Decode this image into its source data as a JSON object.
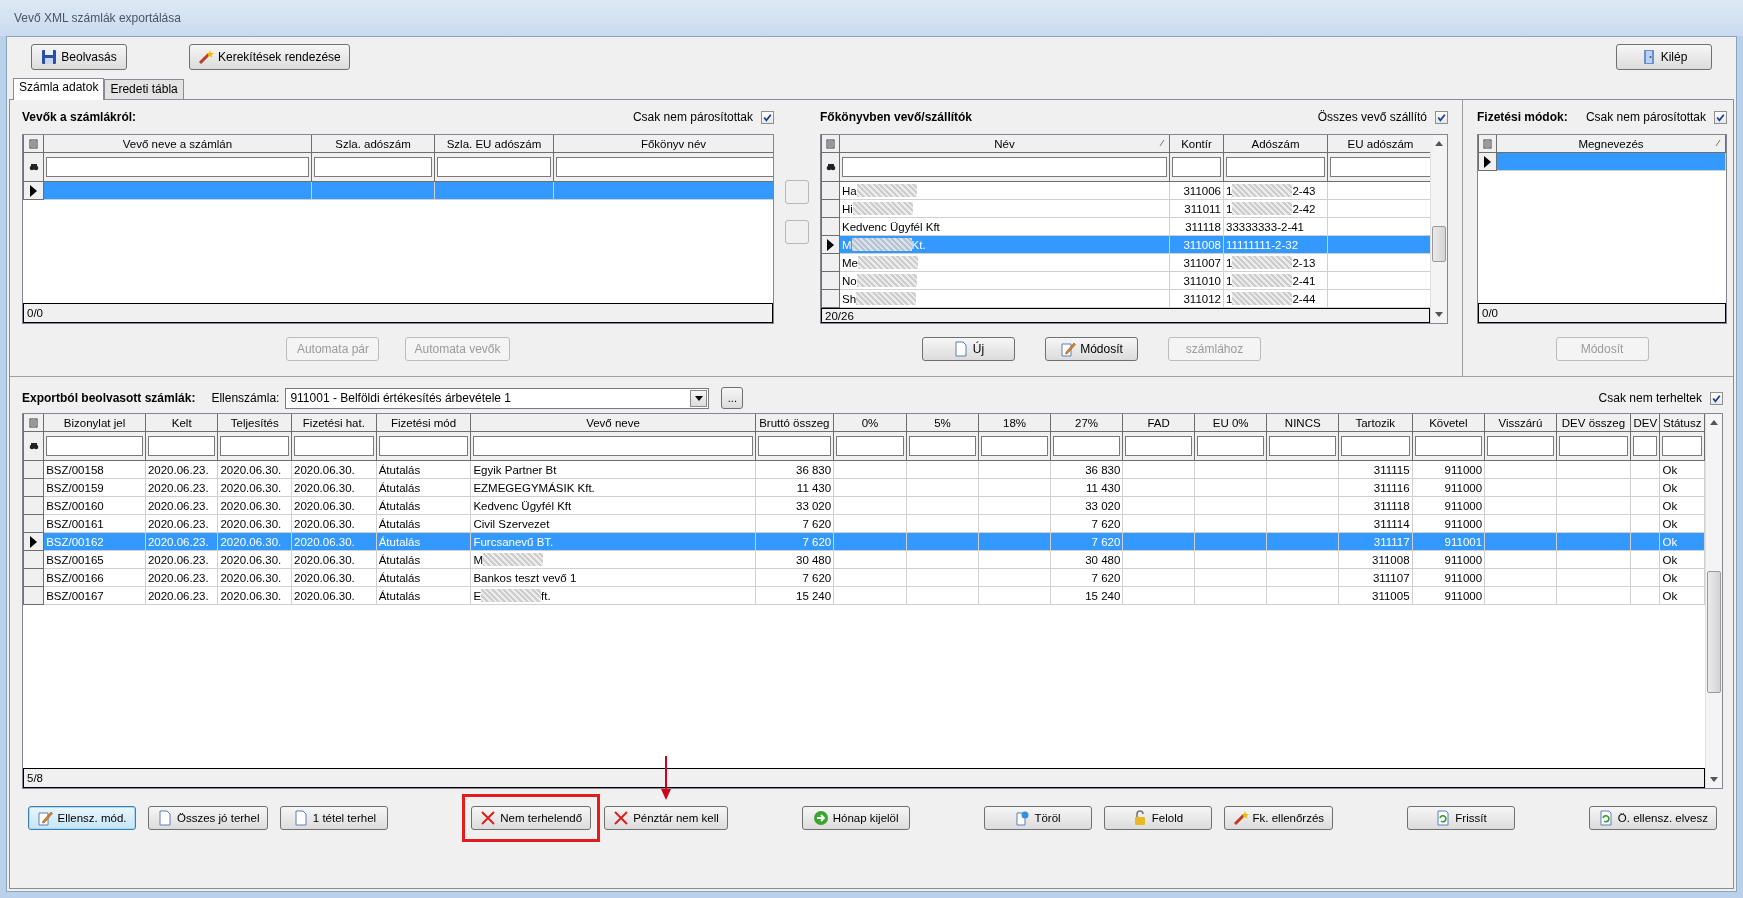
{
  "window": {
    "title": "Vevő XML számlák exportálása"
  },
  "toolbar": {
    "buttons": [
      {
        "label": "Beolvasás"
      },
      {
        "label": "Kerekítések rendezése"
      }
    ],
    "exit": {
      "label": "Kilép"
    }
  },
  "tabs": [
    {
      "label": "Számla adatok",
      "selected": true
    },
    {
      "label": "Eredeti tábla",
      "selected": false
    }
  ],
  "customers_panel": {
    "title": "Vevők a számlákról:",
    "filter": {
      "label": "Csak nem párosítottak",
      "checked": true
    },
    "columns": [
      {
        "label": "Vevő neve a számlán"
      },
      {
        "label": "Szla. adószám"
      },
      {
        "label": "Szla. EU adószám"
      },
      {
        "label": "Főkönyv név"
      }
    ],
    "rows": [
      {
        "selected": true,
        "cells": [
          null,
          null,
          null,
          null
        ]
      }
    ],
    "footer": "0/0",
    "buttons": [
      {
        "label": "Automata pár",
        "disabled": true
      },
      {
        "label": "Automata vevők",
        "disabled": true
      }
    ]
  },
  "ledger_panel": {
    "title": "Főkönyvben vevő/szállítók",
    "filter": {
      "label": "Összes vevő szállító",
      "checked": true
    },
    "columns": [
      {
        "label": "Név",
        "sorted": true
      },
      {
        "label": "Kontír"
      },
      {
        "label": "Adószám"
      },
      {
        "label": "EU adószám"
      }
    ],
    "rows": [
      {
        "selected": false,
        "cells": [
          {
            "text": "Ha",
            "redacted": true
          },
          "311006",
          {
            "text": "1",
            "redacted": true,
            "tail": "2-43"
          },
          null
        ]
      },
      {
        "selected": false,
        "cells": [
          {
            "text": "Hi",
            "redacted": true
          },
          "311011",
          {
            "text": "1",
            "redacted": true,
            "tail": "2-42"
          },
          null
        ]
      },
      {
        "selected": false,
        "cells": [
          "Kedvenc Ügyfél Kft",
          "311118",
          "33333333-2-41",
          null
        ]
      },
      {
        "selected": true,
        "cells": [
          {
            "text": "M",
            "redacted": true,
            "tail": "Kt."
          },
          "311008",
          "11111111-2-32",
          null
        ]
      },
      {
        "selected": false,
        "cells": [
          {
            "text": "Me",
            "redacted": true
          },
          "311007",
          {
            "text": "1",
            "redacted": true,
            "tail": "2-13"
          },
          null
        ]
      },
      {
        "selected": false,
        "cells": [
          {
            "text": "No",
            "redacted": true
          },
          "311010",
          {
            "text": "1",
            "redacted": true,
            "tail": "2-41"
          },
          null
        ]
      },
      {
        "selected": false,
        "cells": [
          {
            "text": "Sh",
            "redacted": true
          },
          "311012",
          {
            "text": "1",
            "redacted": true,
            "tail": "2-44"
          },
          null
        ]
      }
    ],
    "footer": "20/26",
    "buttons": [
      {
        "label": "Új",
        "disabled": false
      },
      {
        "label": "Módosít",
        "disabled": false
      },
      {
        "label": "számlához",
        "disabled": true
      }
    ]
  },
  "payment_panel": {
    "title": "Fizetési módok:",
    "filter": {
      "label": "Csak nem párosítottak",
      "checked": true
    },
    "columns": [
      {
        "label": "Megnevezés",
        "sorted": true
      }
    ],
    "rows": [
      {
        "selected": true,
        "cells": [
          null
        ]
      }
    ],
    "footer": "0/0",
    "buttons": [
      {
        "label": "Módosít",
        "disabled": true
      }
    ]
  },
  "invoices": {
    "title": "Exportból beolvasott számlák:",
    "counter_account": {
      "label": "Ellenszámla:",
      "value": "911001 - Belföldi értékesítés árbevétele 1"
    },
    "browse": "...",
    "filter": {
      "label": "Csak nem terheltek",
      "checked": true
    },
    "columns": [
      {
        "label": "Bizonylat jel"
      },
      {
        "label": "Kelt"
      },
      {
        "label": "Teljesítés"
      },
      {
        "label": "Fizetési hat."
      },
      {
        "label": "Fizetési mód"
      },
      {
        "label": "Vevő neve"
      },
      {
        "label": "Bruttó összeg"
      },
      {
        "label": "0%"
      },
      {
        "label": "5%"
      },
      {
        "label": "18%"
      },
      {
        "label": "27%"
      },
      {
        "label": "FAD"
      },
      {
        "label": "EU 0%"
      },
      {
        "label": "NINCS"
      },
      {
        "label": "Tartozik"
      },
      {
        "label": "Követel"
      },
      {
        "label": "Visszárú"
      },
      {
        "label": "DEV összeg"
      },
      {
        "label": "DEV"
      },
      {
        "label": "Státusz"
      }
    ],
    "rows": [
      {
        "selected": false,
        "cells": [
          "BSZ/00158",
          "2020.06.23.",
          "2020.06.30.",
          "2020.06.30.",
          "Átutalás",
          "Egyik Partner Bt",
          "36 830",
          null,
          null,
          null,
          "36 830",
          null,
          null,
          null,
          "311115",
          "911000",
          null,
          null,
          null,
          "Ok"
        ]
      },
      {
        "selected": false,
        "cells": [
          "BSZ/00159",
          "2020.06.23.",
          "2020.06.30.",
          "2020.06.30.",
          "Átutalás",
          "EZMEGEGYMÁSIK Kft.",
          "11 430",
          null,
          null,
          null,
          "11 430",
          null,
          null,
          null,
          "311116",
          "911000",
          null,
          null,
          null,
          "Ok"
        ]
      },
      {
        "selected": false,
        "cells": [
          "BSZ/00160",
          "2020.06.23.",
          "2020.06.30.",
          "2020.06.30.",
          "Átutalás",
          "Kedvenc Ügyfél Kft",
          "33 020",
          null,
          null,
          null,
          "33 020",
          null,
          null,
          null,
          "311118",
          "911000",
          null,
          null,
          null,
          "Ok"
        ]
      },
      {
        "selected": false,
        "cells": [
          "BSZ/00161",
          "2020.06.23.",
          "2020.06.30.",
          "2020.06.30.",
          "Átutalás",
          "Civil Szervezet",
          "7 620",
          null,
          null,
          null,
          "7 620",
          null,
          null,
          null,
          "311114",
          "911000",
          null,
          null,
          null,
          "Ok"
        ]
      },
      {
        "selected": true,
        "cells": [
          "BSZ/00162",
          "2020.06.23.",
          "2020.06.30.",
          "2020.06.30.",
          "Átutalás",
          "Furcsanevű BT.",
          "7 620",
          null,
          null,
          null,
          "7 620",
          null,
          null,
          null,
          "311117",
          "911001",
          null,
          null,
          null,
          "Ok"
        ]
      },
      {
        "selected": false,
        "cells": [
          "BSZ/00165",
          "2020.06.23.",
          "2020.06.30.",
          "2020.06.30.",
          "Átutalás",
          {
            "text": "M",
            "redacted": true
          },
          "30 480",
          null,
          null,
          null,
          "30 480",
          null,
          null,
          null,
          "311008",
          "911000",
          null,
          null,
          null,
          "Ok"
        ]
      },
      {
        "selected": false,
        "cells": [
          "BSZ/00166",
          "2020.06.23.",
          "2020.06.30.",
          "2020.06.30.",
          "Átutalás",
          "Bankos teszt vevő 1",
          "7 620",
          null,
          null,
          null,
          "7 620",
          null,
          null,
          null,
          "311107",
          "911000",
          null,
          null,
          null,
          "Ok"
        ]
      },
      {
        "selected": false,
        "cells": [
          "BSZ/00167",
          "2020.06.23.",
          "2020.06.30.",
          "2020.06.30.",
          "Átutalás",
          {
            "text": "E",
            "redacted": true,
            "tail": "ft."
          },
          "15 240",
          null,
          null,
          null,
          "15 240",
          null,
          null,
          null,
          "311005",
          "911000",
          null,
          null,
          null,
          "Ok"
        ]
      }
    ],
    "footer": "5/8"
  },
  "bottom_buttons": [
    {
      "label": "Ellensz. mód.",
      "focused": true,
      "highlighted": false,
      "arrow": false
    },
    {
      "label": "Összes jó terhel",
      "focused": false,
      "highlighted": false,
      "arrow": false
    },
    {
      "label": "1 tétel terhel",
      "focused": false,
      "highlighted": false,
      "arrow": false
    },
    {
      "label": "Nem terhelendő",
      "focused": false,
      "highlighted": true,
      "arrow": false
    },
    {
      "label": "Pénztár nem kell",
      "focused": false,
      "highlighted": false,
      "arrow": true
    },
    {
      "label": "Hónap kijelöl",
      "focused": false,
      "highlighted": false,
      "arrow": false
    },
    {
      "label": "Töröl",
      "focused": false,
      "highlighted": false,
      "arrow": false
    },
    {
      "label": "Felold",
      "focused": false,
      "highlighted": false,
      "arrow": false
    },
    {
      "label": "Fk. ellenőrzés",
      "focused": false,
      "highlighted": false,
      "arrow": false
    },
    {
      "label": "Frissít",
      "focused": false,
      "highlighted": false,
      "arrow": false
    },
    {
      "label": "Ö. ellensz. elvesz",
      "focused": false,
      "highlighted": false,
      "arrow": false
    }
  ]
}
